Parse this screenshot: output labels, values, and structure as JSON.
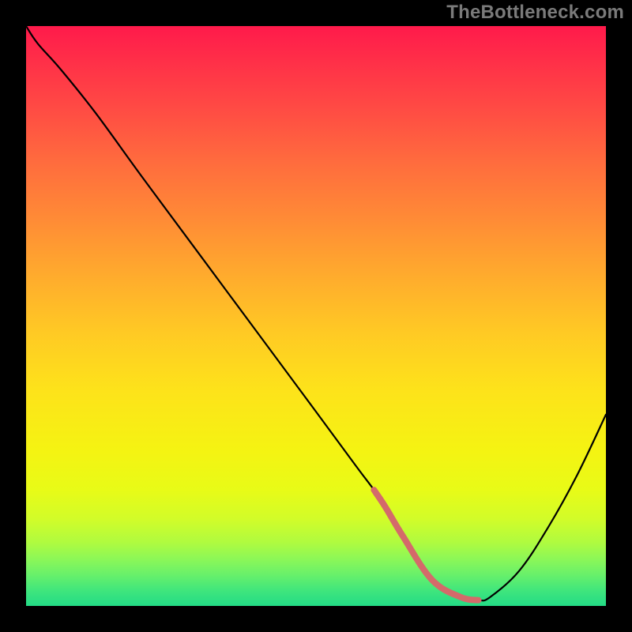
{
  "watermark": "TheBottleneck.com",
  "chart_data": {
    "type": "line",
    "title": "",
    "xlabel": "",
    "ylabel": "",
    "xlim": [
      0,
      100
    ],
    "ylim": [
      0,
      100
    ],
    "gradient_stops": [
      {
        "pct": 0,
        "color": "#ff1a4b"
      },
      {
        "pct": 6,
        "color": "#ff2f48"
      },
      {
        "pct": 14,
        "color": "#ff4a44"
      },
      {
        "pct": 23,
        "color": "#ff6a3e"
      },
      {
        "pct": 33,
        "color": "#ff8a36"
      },
      {
        "pct": 43,
        "color": "#ffab2d"
      },
      {
        "pct": 53,
        "color": "#ffca24"
      },
      {
        "pct": 63,
        "color": "#fde31a"
      },
      {
        "pct": 73,
        "color": "#f5f312"
      },
      {
        "pct": 80,
        "color": "#e8fb17"
      },
      {
        "pct": 85,
        "color": "#d2fc29"
      },
      {
        "pct": 89,
        "color": "#b0fb3f"
      },
      {
        "pct": 92,
        "color": "#8bf758"
      },
      {
        "pct": 95,
        "color": "#63ef6d"
      },
      {
        "pct": 97.5,
        "color": "#3ee57d"
      },
      {
        "pct": 100,
        "color": "#23db86"
      }
    ],
    "series": [
      {
        "name": "curve",
        "stroke": "#000000",
        "x": [
          0,
          2,
          6,
          12,
          20,
          30,
          40,
          50,
          57,
          60,
          62,
          65,
          70,
          75,
          78,
          80,
          85,
          90,
          95,
          100
        ],
        "y": [
          100,
          97,
          92.5,
          85,
          74,
          60.5,
          47,
          33.5,
          24,
          20,
          17,
          12,
          4.5,
          1.5,
          1,
          1.5,
          6,
          13.5,
          22.5,
          33
        ]
      },
      {
        "name": "flat-bottom-highlight",
        "stroke": "#d46a6a",
        "x": [
          60,
          62,
          65,
          70,
          75,
          78
        ],
        "y": [
          20,
          17,
          12,
          4.5,
          1.5,
          1
        ]
      }
    ]
  }
}
